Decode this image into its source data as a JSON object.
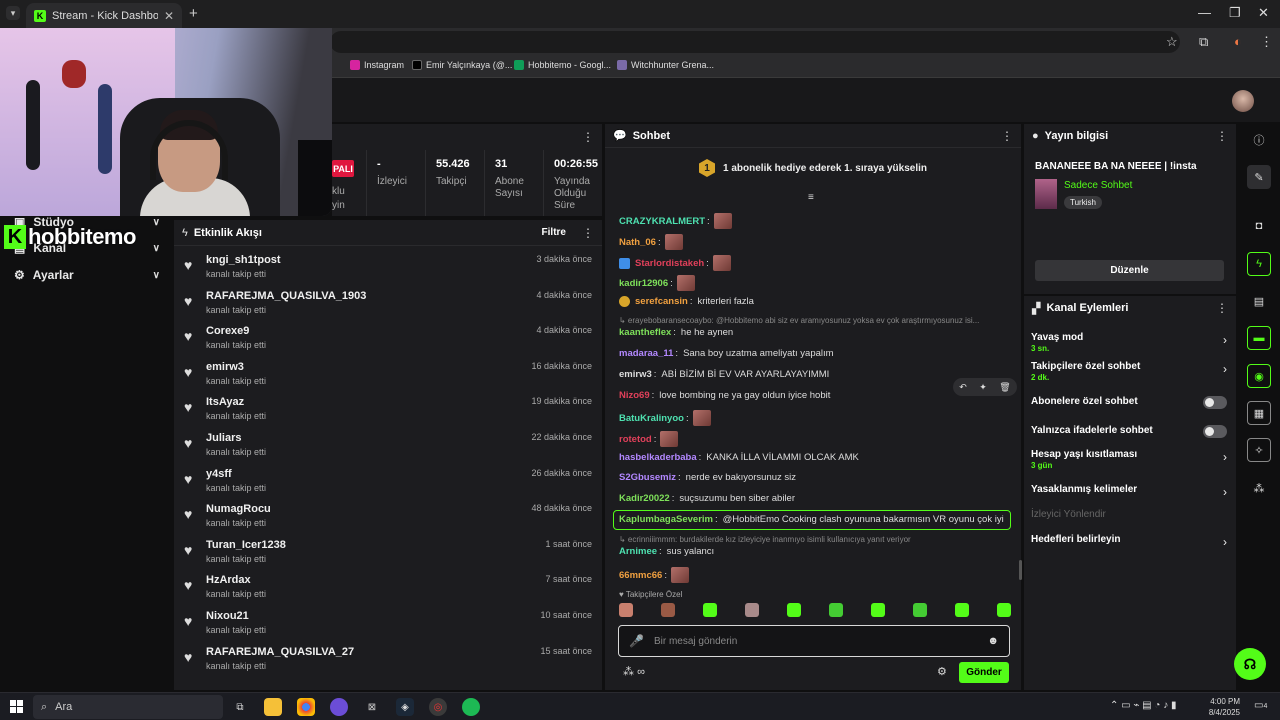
{
  "browser": {
    "tab_title": "Stream - Kick Dashboard",
    "bookmarks": [
      "Instagram",
      "Emir Yalçınkaya (@...",
      "Hobbitemo - Googl...",
      "Witchhunter Grena..."
    ]
  },
  "sidebar": {
    "brand": "hobbitemo",
    "items": [
      {
        "label": "Stüdyo"
      },
      {
        "label": "Kanal"
      },
      {
        "label": "Ayarlar"
      }
    ]
  },
  "stats": {
    "live_badge": "PALI",
    "partial_label": "klu\nyin",
    "viewers_value": "-",
    "viewers_label": "İzleyici",
    "followers_value": "55.426",
    "followers_label": "Takipçi",
    "subs_value": "31",
    "subs_label": "Abone Sayısı",
    "uptime_value": "00:26:55",
    "uptime_label": "Yayında Olduğu Süre"
  },
  "activity": {
    "title": "Etkinlik Akışı",
    "filter_label": "Filtre",
    "events": [
      {
        "user": "kngi_sh1tpost",
        "action": "kanalı takip etti",
        "time": "3 dakika önce"
      },
      {
        "user": "RAFAREJMA_QUASILVA_1903",
        "action": "kanalı takip etti",
        "time": "4 dakika önce"
      },
      {
        "user": "Corexe9",
        "action": "kanalı takip etti",
        "time": "4 dakika önce"
      },
      {
        "user": "emirw3",
        "action": "kanalı takip etti",
        "time": "16 dakika önce"
      },
      {
        "user": "ItsAyaz",
        "action": "kanalı takip etti",
        "time": "19 dakika önce"
      },
      {
        "user": "Juliars",
        "action": "kanalı takip etti",
        "time": "22 dakika önce"
      },
      {
        "user": "y4sff",
        "action": "kanalı takip etti",
        "time": "26 dakika önce"
      },
      {
        "user": "NumagRocu",
        "action": "kanalı takip etti",
        "time": "48 dakika önce"
      },
      {
        "user": "Turan_Icer1238",
        "action": "kanalı takip etti",
        "time": "1 saat önce"
      },
      {
        "user": "HzArdax",
        "action": "kanalı takip etti",
        "time": "7 saat önce"
      },
      {
        "user": "Nixou21",
        "action": "kanalı takip etti",
        "time": "10 saat önce"
      },
      {
        "user": "RAFAREJMA_QUASILVA_27",
        "action": "kanalı takip etti",
        "time": "15 saat önce"
      }
    ]
  },
  "chat": {
    "title": "Sohbet",
    "pinned_badge": "1",
    "pinned_text": "1 abonelik hediye ederek 1. sıraya yükselin",
    "messages": [
      {
        "user": "CRAZYKRALMERT",
        "color": "#4ee1b0",
        "text": "",
        "emote": true
      },
      {
        "user": "Nath_06",
        "color": "#f0a040",
        "text": "",
        "emote": true
      },
      {
        "user": "Starlordistakeh",
        "color": "#e0405a",
        "text": "",
        "emote": true,
        "badge": true
      },
      {
        "user": "kadir12906",
        "color": "#7ee05a",
        "text": "",
        "emote": true
      },
      {
        "user": "serefcansin",
        "color": "#f0a040",
        "text": "kriterleri fazla",
        "gold": true
      },
      {
        "user": "kaantheflex",
        "color": "#7ee05a",
        "text": "he he aynen"
      },
      {
        "user": "madaraa_11",
        "color": "#b388ff",
        "text": "Sana boy uzatma ameliyatı yapalım"
      },
      {
        "user": "emirw3",
        "color": "#dddddd",
        "text": "ABİ BİZİM Bİ EV VAR AYARLAYAYIMMI"
      },
      {
        "user": "Nizo69",
        "color": "#e0405a",
        "text": "love bombing ne ya gay oldun iyice hobit"
      },
      {
        "user": "BatuKralinyoo",
        "color": "#4ee1b0",
        "text": "",
        "emote": true
      },
      {
        "user": "rotetod",
        "color": "#e0405a",
        "text": "",
        "emote": true
      },
      {
        "user": "hasbelkaderbaba",
        "color": "#b388ff",
        "text": "KANKA İLLA VİLAMMI OLCAK AMK"
      },
      {
        "user": "S2Gbusemiz",
        "color": "#b388ff",
        "text": "nerde ev bakıyorsunuz siz"
      },
      {
        "user": "Kadir20022",
        "color": "#7ee05a",
        "text": "suçsuzumu ben siber abiler"
      },
      {
        "user": "KaplumbagaSeverim",
        "color": "#7ee05a",
        "text": "@HobbitEmo Cooking clash oyununa bakarmısın VR oyunu çok iyi"
      },
      {
        "user": "Arnimee",
        "color": "#4ee1b0",
        "text": "sus yalancı"
      },
      {
        "user": "66mmc66",
        "color": "#f0a040",
        "text": "",
        "emote": true
      }
    ],
    "reply_1": "↳ erayebobaransecoaybo: @Hobbitemo abi siz ev aramıyosunuz yoksa ev çok araştırmıyosunuz isi...",
    "reply_2": "↳ ecrinniiimmm: burdakilerde kız izleyiciye inanmıyo isimli kullanıcıya yanıt veriyor",
    "followers_only": "♥ Takipçilere Özel",
    "input_placeholder": "Bir mesaj gönderin",
    "send_label": "Gönder",
    "infinity": "∞"
  },
  "stream_info": {
    "title": "Yayın bilgisi",
    "stream_title": "BANANEEE BA NA NEEEE | !insta",
    "category": "Sadece Sohbet",
    "tag": "Turkish",
    "edit_label": "Düzenle"
  },
  "channel_actions": {
    "title": "Kanal Eylemleri",
    "items": [
      {
        "label": "Yavaş mod",
        "sub": "3 sn."
      },
      {
        "label": "Takipçilere özel sohbet",
        "sub": "2 dk."
      },
      {
        "label": "Abonelere özel sohbet"
      },
      {
        "label": "Yalnızca ifadelerle sohbet"
      },
      {
        "label": "Hesap yaşı kısıtlaması",
        "sub": "3 gün"
      },
      {
        "label": "Yasaklanmış kelimeler"
      },
      {
        "label": "İzleyici Yönlendir"
      },
      {
        "label": "Hedefleri belirleyin"
      }
    ]
  },
  "taskbar": {
    "search_label": "Ara",
    "time": "4:00 PM",
    "date": "8/4/2025",
    "notif_count": "4"
  },
  "colors": {
    "accent": "#53fc18",
    "panel": "#1c1c1f",
    "background": "#0f0f10"
  }
}
